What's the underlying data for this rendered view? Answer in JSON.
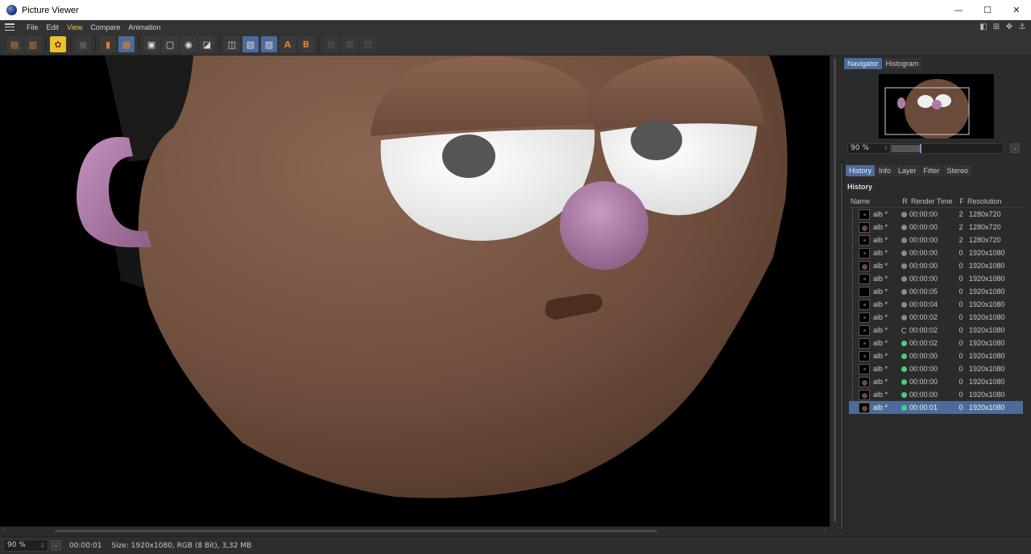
{
  "window": {
    "title": "Picture Viewer",
    "controls": [
      "—",
      "☐",
      "✕"
    ]
  },
  "menu": {
    "items": [
      "File",
      "Edit",
      "View",
      "Compare",
      "Animation"
    ],
    "active": "View"
  },
  "toolbar": {
    "icons": [
      "open-icon",
      "save-icon",
      "render-settings-icon",
      "stop-icon",
      "frames-icon",
      "layers-icon",
      "fit-icon",
      "fit-screen-icon",
      "zoom-fit-icon",
      "ab-compare-icon",
      "channel-icon",
      "split-a-icon",
      "split-b-icon",
      "set-a-icon",
      "set-b-icon",
      "swap-icon",
      "diff-icon",
      "crop-icon"
    ],
    "label_a": "A",
    "label_b": "B"
  },
  "navigator": {
    "tabs": [
      "Navigator",
      "Histogram"
    ],
    "active_tab": "Navigator",
    "zoom": "90 %",
    "zoom_fraction": 0.24
  },
  "history": {
    "tabs": [
      "History",
      "Info",
      "Layer",
      "Filter",
      "Stereo"
    ],
    "active_tab": "History",
    "section_title": "History",
    "columns": {
      "name": "Name",
      "r": "R",
      "time": "Render Time",
      "f": "F",
      "res": "Resolution"
    },
    "rows": [
      {
        "name": "alb *",
        "status": "grey",
        "time": "00:00:00",
        "f": "2",
        "res": "1280x720",
        "thumb": "tiny"
      },
      {
        "name": "alb *",
        "status": "grey",
        "time": "00:00:00",
        "f": "2",
        "res": "1280x720",
        "thumb": "face"
      },
      {
        "name": "alb *",
        "status": "grey",
        "time": "00:00:00",
        "f": "2",
        "res": "1280x720",
        "thumb": "tiny"
      },
      {
        "name": "alb *",
        "status": "grey",
        "time": "00:00:00",
        "f": "0",
        "res": "1920x1080",
        "thumb": "tiny"
      },
      {
        "name": "alb *",
        "status": "grey",
        "time": "00:00:00",
        "f": "0",
        "res": "1920x1080",
        "thumb": "face"
      },
      {
        "name": "alb *",
        "status": "grey",
        "time": "00:00:00",
        "f": "0",
        "res": "1920x1080",
        "thumb": "tiny"
      },
      {
        "name": "alb *",
        "status": "grey",
        "time": "00:00:05",
        "f": "0",
        "res": "1920x1080",
        "thumb": "blank"
      },
      {
        "name": "alb *",
        "status": "grey",
        "time": "00:00:04",
        "f": "0",
        "res": "1920x1080",
        "thumb": "tiny"
      },
      {
        "name": "alb *",
        "status": "grey",
        "time": "00:00:02",
        "f": "0",
        "res": "1920x1080",
        "thumb": "tiny"
      },
      {
        "name": "alb *",
        "status": "ring",
        "time": "00:00:02",
        "f": "0",
        "res": "1920x1080",
        "thumb": "tiny"
      },
      {
        "name": "alb *",
        "status": "green",
        "time": "00:00:02",
        "f": "0",
        "res": "1920x1080",
        "thumb": "tiny"
      },
      {
        "name": "alb *",
        "status": "green",
        "time": "00:00:00",
        "f": "0",
        "res": "1920x1080",
        "thumb": "tiny"
      },
      {
        "name": "alb *",
        "status": "green",
        "time": "00:00:00",
        "f": "0",
        "res": "1920x1080",
        "thumb": "tiny"
      },
      {
        "name": "alb *",
        "status": "green",
        "time": "00:00:00",
        "f": "0",
        "res": "1920x1080",
        "thumb": "face"
      },
      {
        "name": "alb *",
        "status": "green",
        "time": "00:00:00",
        "f": "0",
        "res": "1920x1080",
        "thumb": "face"
      },
      {
        "name": "alb *",
        "status": "green",
        "time": "00:00:01",
        "f": "0",
        "res": "1920x1080",
        "thumb": "face",
        "selected": true
      }
    ]
  },
  "status": {
    "zoom": "90 %",
    "time": "00:00:01",
    "info": "Size: 1920x1080, RGB (8 Bit), 3,32 MB"
  }
}
